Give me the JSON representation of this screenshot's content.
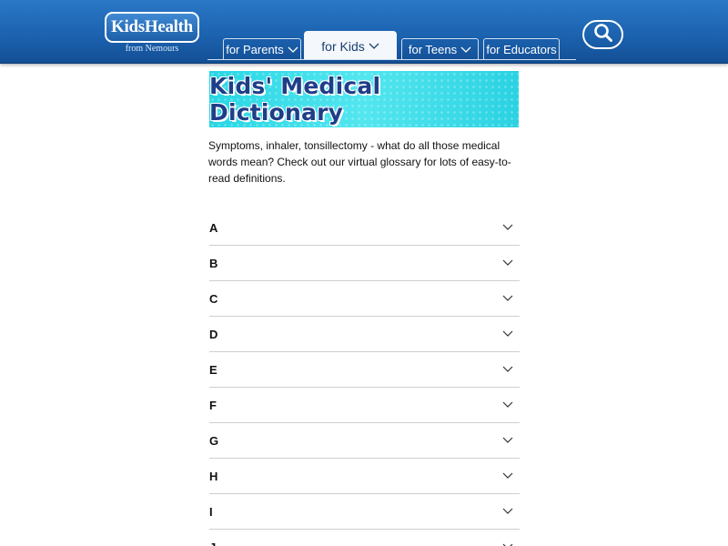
{
  "header": {
    "logo_text": "KidsHealth",
    "logo_sub": "from Nemours",
    "tabs": [
      {
        "label": "for Parents",
        "active": false
      },
      {
        "label": "for Kids",
        "active": true
      },
      {
        "label": "for Teens",
        "active": false
      },
      {
        "label": "for Educators",
        "active": false
      }
    ],
    "search_icon": "search-icon",
    "colors": {
      "header_blue": "#1c63b0",
      "active_tab": "#f4f7fb"
    }
  },
  "banner": {
    "title": "Kids' Medical Dictionary",
    "colors": {
      "background": "#3fdfea",
      "text": "#1f3e88"
    }
  },
  "intro": "Symptoms, inhaler, tonsillectomy - what do all those medical words mean? Check out our virtual glossary for lots of easy-to-read definitions.",
  "accordion": {
    "items": [
      "A",
      "B",
      "C",
      "D",
      "E",
      "F",
      "G",
      "H",
      "I",
      "J"
    ],
    "expand_icon": "chevron-down-icon"
  }
}
